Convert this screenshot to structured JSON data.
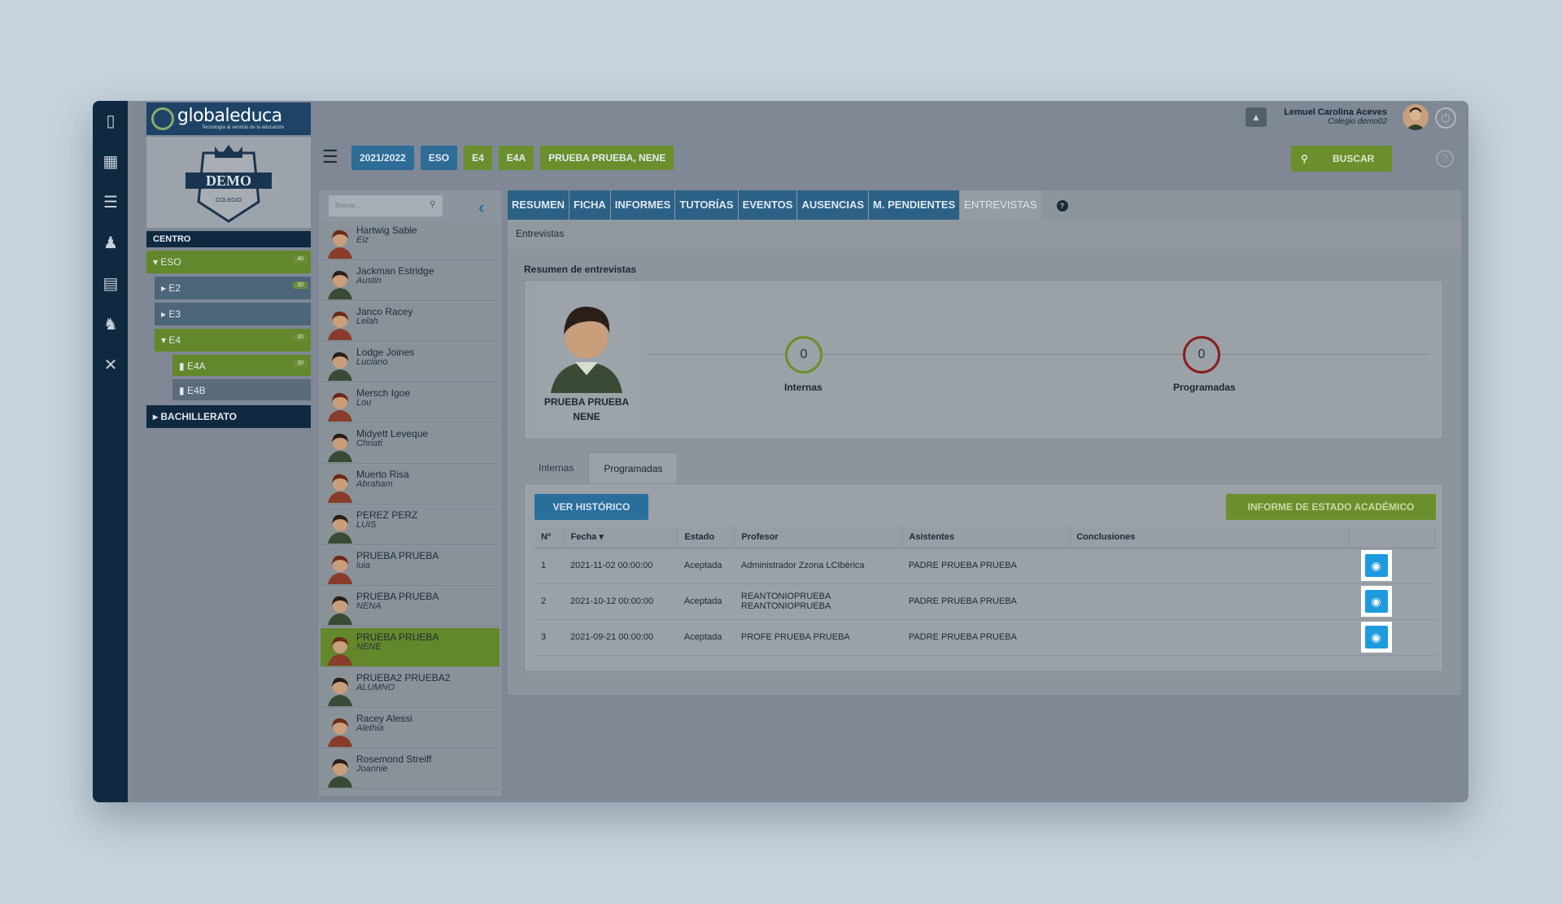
{
  "app": {
    "logo_text": "globaleduca",
    "logo_sub": "Tecnología al servicio de la educación",
    "crest_text": "DEMO",
    "crest_sub": "COLEGIO"
  },
  "user": {
    "name": "Lemuel Carolina Aceves",
    "org": "Colegio demo02"
  },
  "sidebar": {
    "centro_label": "CENTRO",
    "tree": [
      {
        "label": "ESO",
        "count": "40"
      },
      {
        "label": "E2",
        "count": "30"
      },
      {
        "label": "E3",
        "count": ""
      },
      {
        "label": "E4",
        "count": "30"
      },
      {
        "label": "E4A",
        "count": "30"
      },
      {
        "label": "E4B",
        "count": ""
      },
      {
        "label": "BACHILLERATO",
        "count": ""
      }
    ]
  },
  "breadcrumbs": [
    "2021/2022",
    "ESO",
    "E4",
    "E4A",
    "PRUEBA PRUEBA, NENE"
  ],
  "search": {
    "button_label": "BUSCAR",
    "placeholder": "Buscar..."
  },
  "students": [
    {
      "name": "Hartwig Sable",
      "sub": "Eiz"
    },
    {
      "name": "Jackman Estridge",
      "sub": "Austin"
    },
    {
      "name": "Janco Racey",
      "sub": "Lelah"
    },
    {
      "name": "Lodge Joines",
      "sub": "Luciano"
    },
    {
      "name": "Mersch Igoe",
      "sub": "Lou"
    },
    {
      "name": "Midyett Leveque",
      "sub": "Chriati"
    },
    {
      "name": "Muerto Risa",
      "sub": "Abraham"
    },
    {
      "name": "PEREZ PERZ",
      "sub": "LUIS"
    },
    {
      "name": "PRUEBA PRUEBA",
      "sub": "luia"
    },
    {
      "name": "PRUEBA PRUEBA",
      "sub": "NENA"
    },
    {
      "name": "PRUEBA PRUEBA",
      "sub": "NENE"
    },
    {
      "name": "PRUEBA2 PRUEBA2",
      "sub": "ALUMNO"
    },
    {
      "name": "Racey Alessi",
      "sub": "Alethia"
    },
    {
      "name": "Rosemond Streiff",
      "sub": "Joannie"
    }
  ],
  "tabs": [
    "RESUMEN",
    "FICHA",
    "INFORMES",
    "TUTORÍAS",
    "EVENTOS",
    "AUSENCIAS",
    "M. PENDIENTES",
    "ENTREVISTAS"
  ],
  "main": {
    "section_title": "Entrevistas",
    "resumen_title": "Resumen de entrevistas",
    "profile_name_1": "PRUEBA PRUEBA",
    "profile_name_2": "NENE",
    "internas_count": "0",
    "internas_label": "Internas",
    "programadas_count": "0",
    "programadas_label": "Programadas",
    "subtabs": [
      "Internas",
      "Programadas"
    ],
    "btn_historico": "VER HISTÓRICO",
    "btn_informe": "INFORME DE ESTADO ACADÉMICO",
    "columns": [
      "Nº",
      "Fecha ▾",
      "Estado",
      "Profesor",
      "Asistentes",
      "Conclusiones"
    ],
    "rows": [
      {
        "n": "1",
        "fecha": "2021-11-02 00:00:00",
        "estado": "Aceptada",
        "profesor": "Administrador Zzona LCIbérica",
        "asistentes": "PADRE PRUEBA PRUEBA",
        "conclusiones": ""
      },
      {
        "n": "2",
        "fecha": "2021-10-12 00:00:00",
        "estado": "Aceptada",
        "profesor": "REANTONIOPRUEBA REANTONIOPRUEBA",
        "asistentes": "PADRE PRUEBA PRUEBA",
        "conclusiones": ""
      },
      {
        "n": "3",
        "fecha": "2021-09-21 00:00:00",
        "estado": "Aceptada",
        "profesor": "PROFE PRUEBA PRUEBA",
        "asistentes": "PADRE PRUEBA PRUEBA",
        "conclusiones": ""
      }
    ]
  },
  "colors": {
    "accent_blue": "#2c6187",
    "accent_green": "#6b8f2c",
    "eye_button": "#1e9bdf",
    "nav_dark": "#0f2a40"
  }
}
